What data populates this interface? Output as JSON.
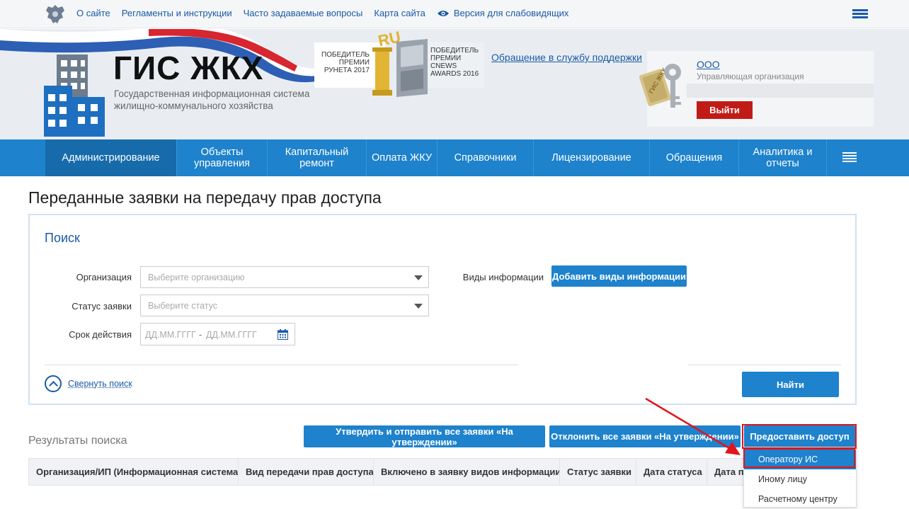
{
  "topbar": {
    "links": [
      "О сайте",
      "Регламенты и инструкции",
      "Часто задаваемые вопросы",
      "Карта сайта"
    ],
    "accessibility": "Версия для слабовидящих"
  },
  "header": {
    "logo_title": "ГИС ЖКХ",
    "logo_subtitle_1": "Государственная информационная система",
    "logo_subtitle_2": "жилищно-коммунального хозяйства",
    "award1": [
      "ПОБЕДИТЕЛЬ",
      "ПРЕМИИ",
      "РУНЕТА 2017"
    ],
    "award2": [
      "ПОБЕДИТЕЛЬ",
      "ПРЕМИИ",
      "CNEWS",
      "AWARDS 2016"
    ],
    "award_logo": "RU",
    "support_link": "Обращение в службу поддержки",
    "user_org": "ООО",
    "user_role": "Управляющая организация",
    "keys_label": "ГИС ЖКХ",
    "logout": "Выйти"
  },
  "nav": {
    "items": [
      {
        "label": "Администрирование"
      },
      {
        "label": "Объекты управления"
      },
      {
        "label": "Капитальный ремонт"
      },
      {
        "label": "Оплата ЖКУ"
      },
      {
        "label": "Справочники"
      },
      {
        "label": "Лицензирование"
      },
      {
        "label": "Обращения"
      },
      {
        "label": "Аналитика и отчеты"
      }
    ]
  },
  "page": {
    "title": "Переданные заявки на передачу прав доступа"
  },
  "search": {
    "title": "Поиск",
    "org_label": "Организация",
    "org_placeholder": "Выберите организацию",
    "status_label": "Статус заявки",
    "status_placeholder": "Выберите статус",
    "period_label": "Срок действия",
    "date_from": "ДД.ММ.ГГГГ",
    "date_sep": "-",
    "date_to": "ДД.ММ.ГГГГ",
    "info_label": "Виды информации",
    "add_info_button": "Добавить виды информации",
    "collapse": "Свернуть поиск",
    "find_button": "Найти"
  },
  "results": {
    "title": "Результаты поиска",
    "approve_all": "Утвердить и отправить все заявки «На утверждении»",
    "reject_all": "Отклонить все заявки «На утверждении»",
    "grant_access": "Предоставить доступ",
    "columns": [
      "Организация/ИП (Информационная система)",
      "Вид передачи прав доступа",
      "Включено в заявку видов информации",
      "Статус заявки",
      "Дата статуса",
      "Дата по"
    ]
  },
  "dropdown": {
    "items": [
      "Оператору ИС",
      "Иному лицу",
      "Расчетному центру"
    ],
    "selected_index": 0
  },
  "colors": {
    "primary": "#1e82cc",
    "nav_active": "#176bab",
    "logout": "#c11b17",
    "highlight": "#e3141b"
  }
}
